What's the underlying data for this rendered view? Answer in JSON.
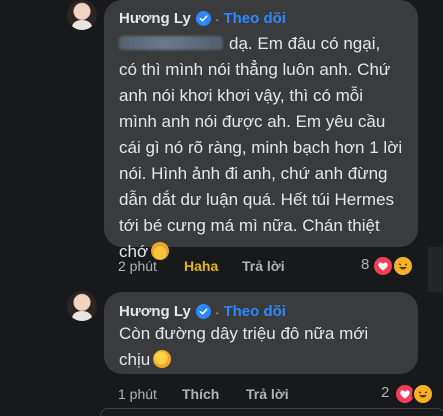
{
  "comments": [
    {
      "author": "Hương Ly",
      "follow_label": "Theo dõi",
      "dot": "·",
      "text_first": "dạ. Em đâu có ngại,",
      "lines": [
        "có thì mình nói thẳng luôn anh. Chứ",
        "anh nói khơi khơi vậy, thì có mỗi",
        "mình anh nói được ah. Em yêu cầu",
        "cái gì nó rõ ràng, minh bạch hơn 1 lời",
        "nói. Hình ảnh đi anh, chứ anh đừng",
        "dẫn dắt dư luận quá. Hết túi Hermes",
        "tới bé cưng má mì nữa. Chán thiệt",
        "chớ"
      ],
      "emoji": "woman-facepalming-emoji",
      "time": "2 phút",
      "reaction_label": "Haha",
      "reply_label": "Trả lời",
      "reaction_count": "8",
      "reaction_icons": [
        "heart-icon",
        "laugh-icon"
      ]
    },
    {
      "author": "Hương Ly",
      "follow_label": "Theo dõi",
      "dot": "·",
      "lines": [
        "Còn đường dây triệu đô nữa mới",
        "chịu"
      ],
      "emoji": "rolling-laughing-emoji",
      "time": "1 phút",
      "reaction_label": "Thích",
      "reply_label": "Trả lời",
      "reaction_count": "2",
      "reaction_icons": [
        "heart-icon",
        "laugh-icon"
      ]
    }
  ],
  "colors": {
    "background": "#18191a",
    "bubble": "#3a3b3c",
    "link_blue": "#2d88ff",
    "haha_yellow": "#e2b80b",
    "heart": "#f33e58",
    "laugh": "#f7b125"
  }
}
